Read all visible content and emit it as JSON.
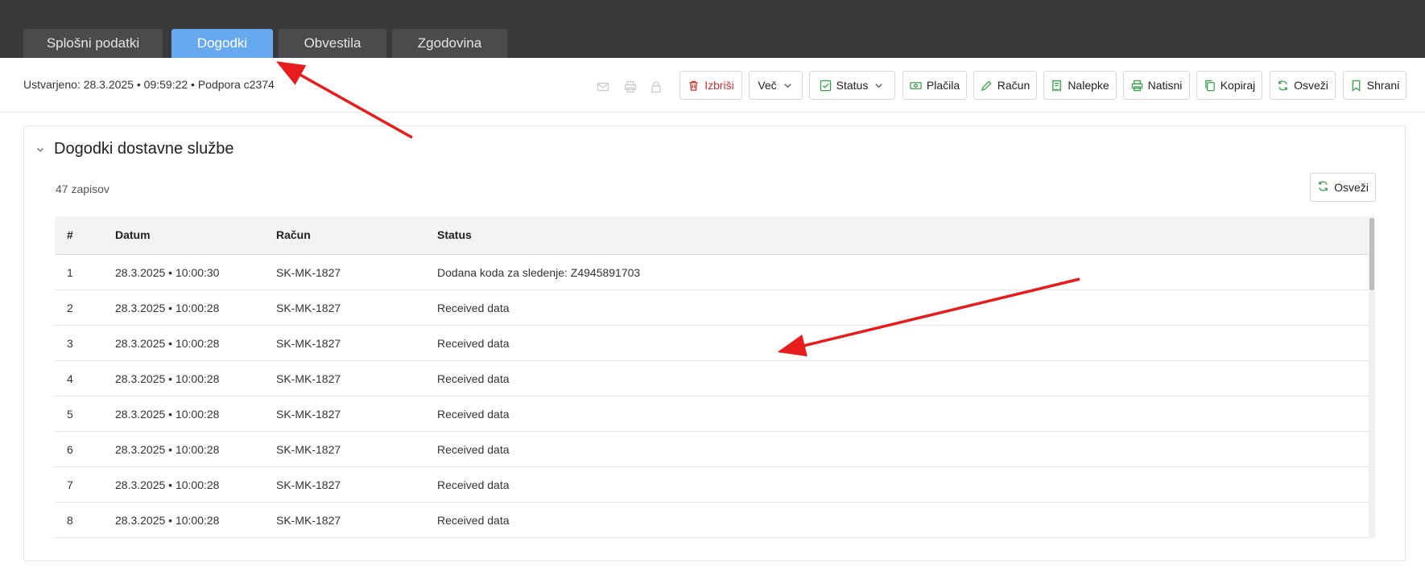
{
  "tabs": [
    {
      "label": "Splošni podatki",
      "active": false
    },
    {
      "label": "Dogodki",
      "active": true
    },
    {
      "label": "Obvestila",
      "active": false
    },
    {
      "label": "Zgodovina",
      "active": false
    }
  ],
  "info": {
    "created": "Ustvarjeno: 28.3.2025 • 09:59:22 • Podpora c2374"
  },
  "toolbar": {
    "mini_icons": [
      "mail-icon",
      "print-icon",
      "lock-icon"
    ],
    "buttons": [
      {
        "label": "Izbriši",
        "icon": "trash-icon",
        "color": "#d32f2f"
      },
      {
        "label": "Več",
        "icon": "chevron-down-icon"
      },
      {
        "label": "Status",
        "icon": "check-square-icon"
      },
      {
        "label": "Plačila",
        "icon": "money-icon"
      },
      {
        "label": "Račun",
        "icon": "pencil-icon"
      },
      {
        "label": "Nalepke",
        "icon": "receipt-icon"
      },
      {
        "label": "Natisni",
        "icon": "print-icon"
      },
      {
        "label": "Kopiraj",
        "icon": "copy-icon"
      },
      {
        "label": "Osveži",
        "icon": "refresh-icon"
      },
      {
        "label": "Shrani",
        "icon": "bookmark-icon"
      }
    ]
  },
  "panel": {
    "title": "Dogodki dostavne službe",
    "count": "47 zapisov",
    "refresh_label": "Osveži"
  },
  "table": {
    "headers": [
      "#",
      "Datum",
      "Račun",
      "Status"
    ],
    "rows": [
      [
        "1",
        "28.3.2025 • 10:00:30",
        "SK-MK-1827",
        "Dodana koda za sledenje: Z4945891703"
      ],
      [
        "2",
        "28.3.2025 • 10:00:28",
        "SK-MK-1827",
        "Received data"
      ],
      [
        "3",
        "28.3.2025 • 10:00:28",
        "SK-MK-1827",
        "Received data"
      ],
      [
        "4",
        "28.3.2025 • 10:00:28",
        "SK-MK-1827",
        "Received data"
      ],
      [
        "5",
        "28.3.2025 • 10:00:28",
        "SK-MK-1827",
        "Received data"
      ],
      [
        "6",
        "28.3.2025 • 10:00:28",
        "SK-MK-1827",
        "Received data"
      ],
      [
        "7",
        "28.3.2025 • 10:00:28",
        "SK-MK-1827",
        "Received data"
      ],
      [
        "8",
        "28.3.2025 • 10:00:28",
        "SK-MK-1827",
        "Received data"
      ]
    ]
  },
  "colors": {
    "topbar": "#3a3a3c",
    "tab": "#4b4b4e",
    "tab_active": "#66a9f0",
    "icon_green": "#3aa34a",
    "danger": "#d32f2f",
    "annotation_arrow": "#e81c1c"
  }
}
